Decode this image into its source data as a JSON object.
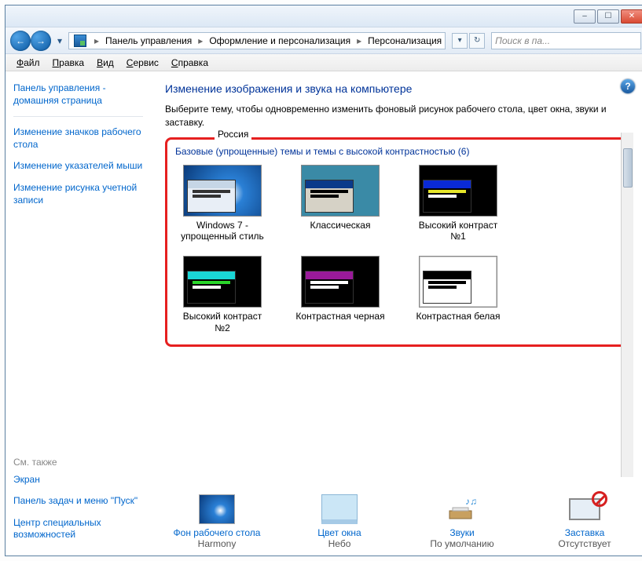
{
  "titlebar": {
    "minimize": "–",
    "maximize": "☐",
    "close": "✕"
  },
  "nav": {
    "back": "←",
    "forward": "→",
    "dropdown": "▾",
    "refresh": "↻",
    "bc_dropdown": "▾",
    "breadcrumb": [
      "Панель управления",
      "Оформление и персонализация",
      "Персонализация"
    ],
    "bc_sep": "▸",
    "search_placeholder": "Поиск в па..."
  },
  "menu": {
    "items": [
      {
        "ul": "Ф",
        "rest": "айл"
      },
      {
        "ul": "П",
        "rest": "равка"
      },
      {
        "ul": "В",
        "rest": "ид"
      },
      {
        "ul": "С",
        "rest": "ервис"
      },
      {
        "ul": "С",
        "rest": "правка"
      }
    ]
  },
  "sidebar": {
    "home": "Панель управления - домашняя страница",
    "links": [
      "Изменение значков рабочего стола",
      "Изменение указателей мыши",
      "Изменение рисунка учетной записи"
    ],
    "see_also_hdr": "См. также",
    "see_also": [
      "Экран",
      "Панель задач и меню \"Пуск\"",
      "Центр специальных возможностей"
    ]
  },
  "content": {
    "help": "?",
    "title": "Изменение изображения и звука на компьютере",
    "subtitle": "Выберите тему, чтобы одновременно изменить фоновый рисунок рабочего стола, цвет окна, звуки и заставку.",
    "partial_label": "Россия",
    "section_title": "Базовые (упрощенные) темы и темы с высокой контрастностью (6)",
    "themes": [
      {
        "label": "Windows 7 - упрощенный стиль"
      },
      {
        "label": "Классическая"
      },
      {
        "label": "Высокий контраст №1"
      },
      {
        "label": "Высокий контраст №2"
      },
      {
        "label": "Контрастная черная"
      },
      {
        "label": "Контрастная белая"
      }
    ],
    "bottom": [
      {
        "label": "Фон рабочего стола",
        "value": "Harmony"
      },
      {
        "label": "Цвет окна",
        "value": "Небо"
      },
      {
        "label": "Звуки",
        "value": "По умолчанию"
      },
      {
        "label": "Заставка",
        "value": "Отсутствует"
      }
    ]
  }
}
